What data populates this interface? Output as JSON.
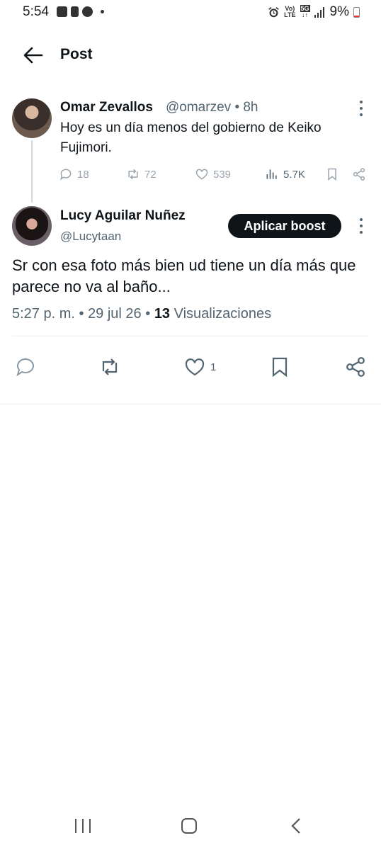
{
  "status_bar": {
    "time": "5:54",
    "network_top": "Vo)",
    "network_bottom": "LTE",
    "data_type": "5G",
    "battery": "9%"
  },
  "header": {
    "title": "Post"
  },
  "parent_tweet": {
    "name": "Omar Zevallos",
    "handle": "@omarzev",
    "time": "• 8h",
    "text": "Hoy es un día menos del gobierno de Keiko Fujimori.",
    "replies": "18",
    "retweets": "72",
    "likes": "539",
    "views": "5.7K"
  },
  "reply": {
    "name": "Lucy Aguilar Nuñez",
    "handle": "@Lucytaan",
    "boost_label": "Aplicar boost",
    "text": "Sr con esa foto más bien ud tiene un día más que parece no va al baño...",
    "time": "5:27 p. m.",
    "date": "29 jul 26",
    "view_count": "13",
    "view_label": "Visualizaciones",
    "likes": "1"
  },
  "colors": {
    "text_primary": "#0f1419",
    "text_secondary": "#536471",
    "muted_icon": "#9aa4ad",
    "divider": "#eff3f4"
  }
}
